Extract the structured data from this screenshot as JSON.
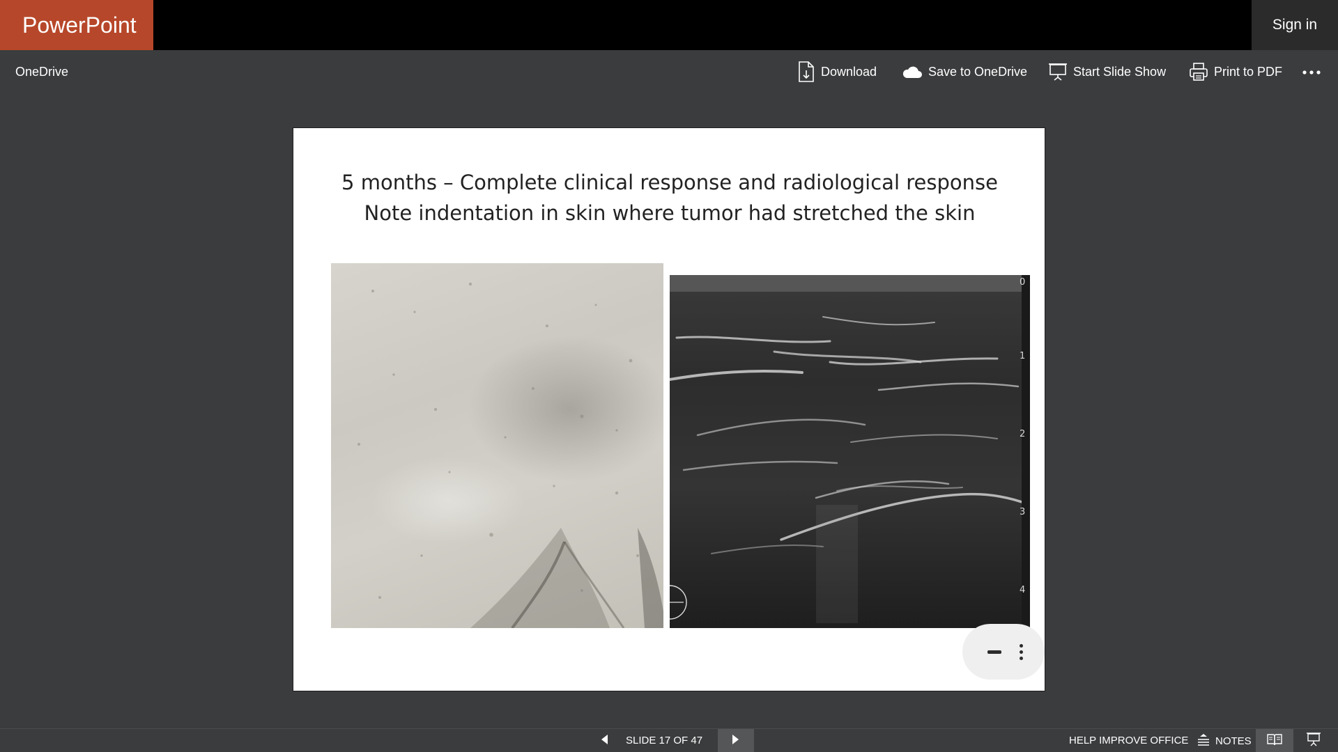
{
  "app": {
    "title": "PowerPoint",
    "sign_in": "Sign in",
    "brand_color": "#b7472a"
  },
  "commandbar": {
    "breadcrumb": "OneDrive",
    "download": "Download",
    "save_to_onedrive": "Save to OneDrive",
    "start_slide_show": "Start Slide Show",
    "print_to_pdf": "Print to PDF",
    "more_icon": "ellipsis-icon"
  },
  "slide": {
    "title_line1": "5 months – Complete clinical response and radiological response",
    "title_line2": "Note indentation in skin where tumor had stretched the skin",
    "images": [
      "skin-photo",
      "ultrasound-image"
    ],
    "depth_scale": [
      "0",
      "1",
      "2",
      "3",
      "4"
    ]
  },
  "statusbar": {
    "slide_counter": "SLIDE 17 OF 47",
    "help": "HELP IMPROVE OFFICE",
    "notes": "NOTES"
  }
}
